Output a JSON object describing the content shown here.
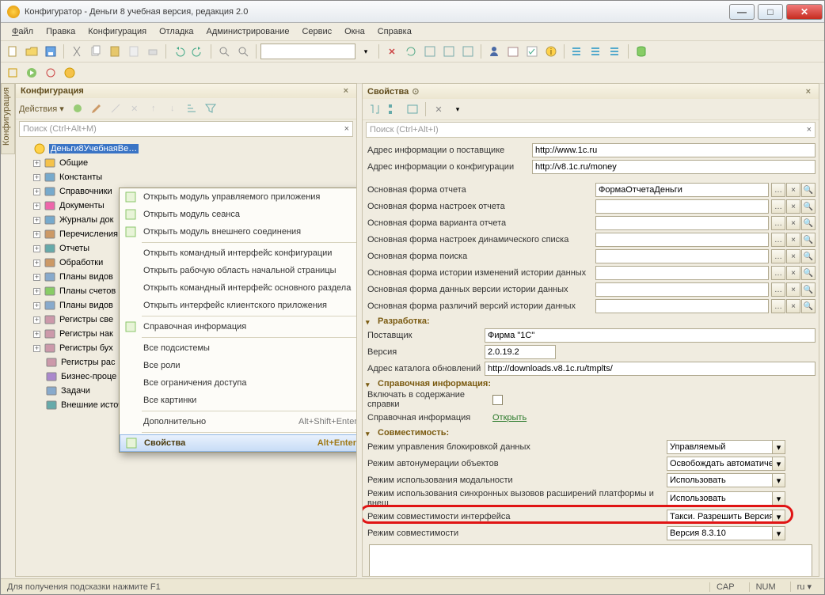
{
  "window": {
    "title": "Конфигуратор - Деньги 8 учебная версия, редакция 2.0"
  },
  "menu": {
    "file": "Файл",
    "edit": "Правка",
    "config": "Конфигурация",
    "debug": "Отладка",
    "admin": "Администрирование",
    "service": "Сервис",
    "windows": "Окна",
    "help": "Справка"
  },
  "vtab": "Конфигурация",
  "left": {
    "title": "Конфигурация",
    "actions": "Действия",
    "search_ph": "Поиск (Ctrl+Alt+M)",
    "root": "Деньги8УчебнаяВе…",
    "items": [
      "Общие",
      "Константы",
      "Справочники",
      "Документы",
      "Журналы док",
      "Перечисления",
      "Отчеты",
      "Обработки",
      "Планы видов",
      "Планы счетов",
      "Планы видов",
      "Регистры све",
      "Регистры нак",
      "Регистры бух",
      "Регистры рас",
      "Бизнес-проце",
      "Задачи",
      "Внешние источники данных"
    ]
  },
  "ctx": {
    "items": [
      {
        "label": "Открыть модуль управляемого приложения",
        "icon": "module-icon"
      },
      {
        "label": "Открыть модуль сеанса",
        "icon": "module-icon"
      },
      {
        "label": "Открыть модуль внешнего соединения",
        "icon": "module-icon"
      },
      {
        "label": "Открыть командный интерфейс конфигурации"
      },
      {
        "label": "Открыть рабочую область начальной страницы"
      },
      {
        "label": "Открыть командный интерфейс основного раздела"
      },
      {
        "label": "Открыть интерфейс клиентского приложения"
      },
      {
        "label": "Справочная информация",
        "icon": "help-icon"
      },
      {
        "label": "Все подсистемы"
      },
      {
        "label": "Все роли"
      },
      {
        "label": "Все ограничения доступа"
      },
      {
        "label": "Все картинки"
      },
      {
        "label": "Дополнительно",
        "shortcut": "Alt+Shift+Enter"
      },
      {
        "label": "Свойства",
        "icon": "properties-icon",
        "shortcut": "Alt+Enter",
        "hi": true
      }
    ]
  },
  "right": {
    "title": "Свойства",
    "search_ph": "Поиск (Ctrl+Alt+I)",
    "vendor_info_label": "Адрес информации о поставщике",
    "vendor_info": "http://www.1c.ru",
    "config_info_label": "Адрес информации о конфигурации",
    "config_info": "http://v8.1c.ru/money",
    "form_report": "Основная форма отчета",
    "form_report_val": "ФормаОтчетаДеньги",
    "form_settings": "Основная форма настроек отчета",
    "form_variant": "Основная форма варианта отчета",
    "form_dynlist": "Основная форма настроек динамического списка",
    "form_search": "Основная форма поиска",
    "form_histchg": "Основная форма истории изменений истории данных",
    "form_histver": "Основная форма данных версии истории данных",
    "form_histdiff": "Основная форма различий версий истории данных",
    "sec_dev": "Разработка:",
    "vendor_label": "Поставщик",
    "vendor": "Фирма \"1С\"",
    "version_label": "Версия",
    "version": "2.0.19.2",
    "updates_label": "Адрес каталога обновлений",
    "updates": "http://downloads.v8.1c.ru/tmplts/",
    "sec_help": "Справочная информация:",
    "include_help": "Включать в содержание справки",
    "help_info": "Справочная информация",
    "open": "Открыть",
    "sec_compat": "Совместимость:",
    "lock_mode": "Режим управления блокировкой данных",
    "lock_val": "Управляемый",
    "autonum": "Режим автонумерации объектов",
    "autonum_val": "Освобождать автоматиче",
    "modal": "Режим использования модальности",
    "modal_val": "Использовать",
    "sync": "Режим использования синхронных вызовов расширений платформы и внеш",
    "sync_val": "Использовать",
    "iface": "Режим совместимости интерфейса",
    "iface_val": "Такси. Разрешить Версия",
    "compat": "Режим совместимости",
    "compat_val": "Версия 8.3.10"
  },
  "status": {
    "hint": "Для получения подсказки нажмите F1",
    "cap": "CAP",
    "num": "NUM",
    "lang": "ru"
  }
}
